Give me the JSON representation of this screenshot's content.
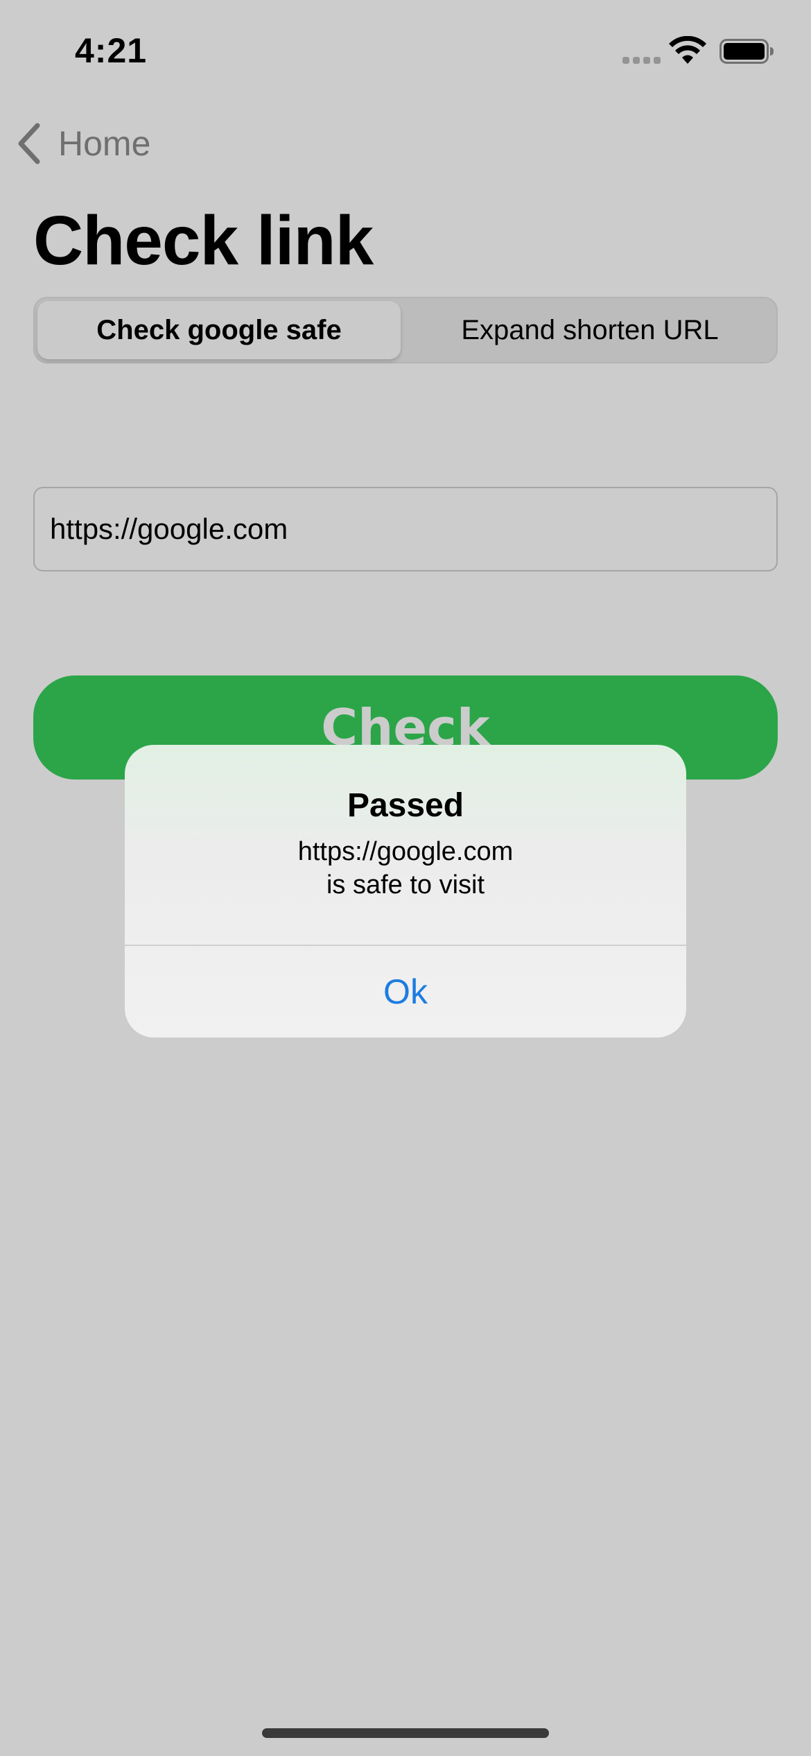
{
  "status_bar": {
    "time": "4:21",
    "icons": [
      "signal-icon",
      "wifi-icon",
      "battery-icon"
    ]
  },
  "nav": {
    "back_label": "Home",
    "back_icon": "chevron-left-icon"
  },
  "page": {
    "title": "Check link"
  },
  "segmented_control": {
    "segments": [
      "Check google safe",
      "Expand shorten URL"
    ],
    "selected_index": 0
  },
  "url_field": {
    "value": "https://google.com"
  },
  "check_button": {
    "label": "Check"
  },
  "alert": {
    "title": "Passed",
    "message_line1": "https://google.com",
    "message_line2": "is safe to visit",
    "ok_label": "Ok"
  },
  "colors": {
    "accent_green": "#36cf5a",
    "link_blue": "#1c7de0",
    "background": "#ffffff"
  }
}
